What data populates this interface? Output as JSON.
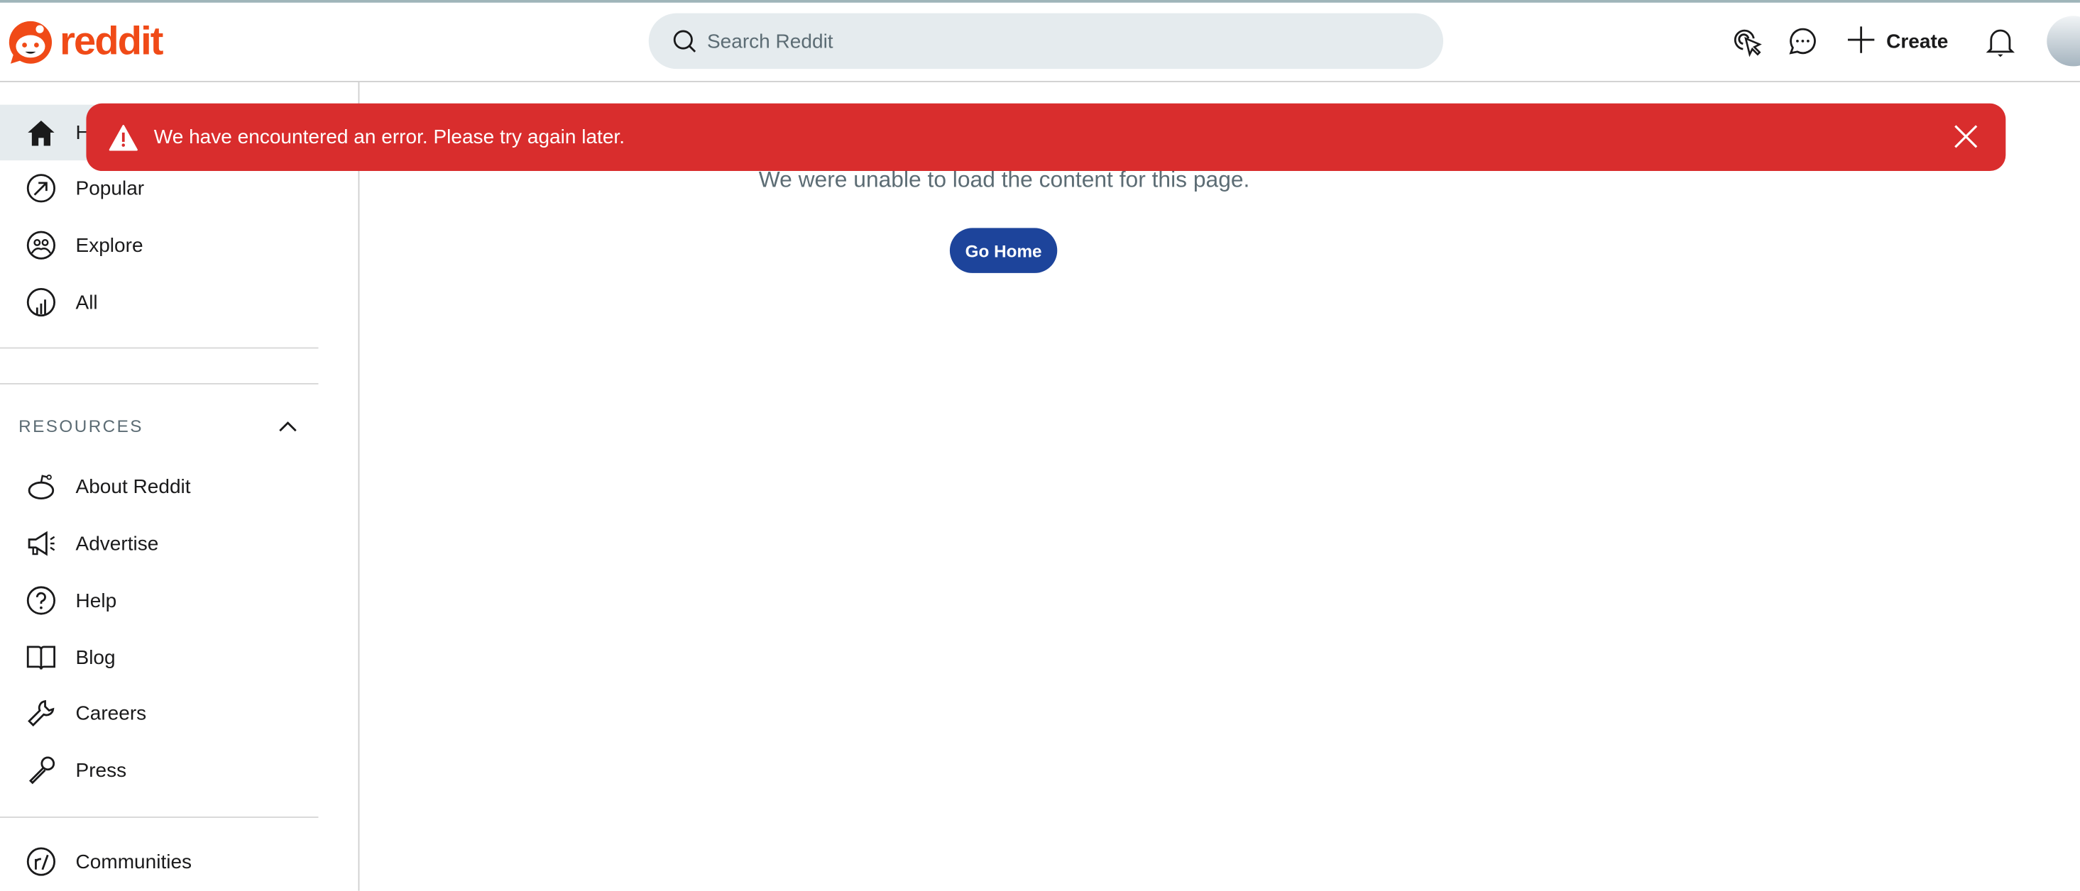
{
  "header": {
    "logo_text": "reddit",
    "search_placeholder": "Search Reddit",
    "create_label": "Create",
    "icons": [
      "advertise-cursor-icon",
      "chat-icon",
      "plus-icon",
      "bell-icon"
    ]
  },
  "sidebar": {
    "items": [
      {
        "label": "Home",
        "icon": "home-icon",
        "active": true
      },
      {
        "label": "Popular",
        "icon": "popular-arrow-icon"
      },
      {
        "label": "Explore",
        "icon": "explore-icon"
      },
      {
        "label": "All",
        "icon": "all-chart-icon"
      }
    ],
    "resources_heading": "RESOURCES",
    "resources": [
      {
        "label": "About Reddit",
        "icon": "reddit-alien-icon"
      },
      {
        "label": "Advertise",
        "icon": "megaphone-icon"
      },
      {
        "label": "Help",
        "icon": "help-icon"
      },
      {
        "label": "Blog",
        "icon": "book-icon"
      },
      {
        "label": "Careers",
        "icon": "wrench-icon"
      },
      {
        "label": "Press",
        "icon": "microphone-icon"
      }
    ],
    "communities_label": "Communities"
  },
  "banner": {
    "message": "We have encountered an error. Please try again later.",
    "color": "#d92d2d"
  },
  "main": {
    "error_text": "We were unable to load the content for this page.",
    "go_home_label": "Go Home",
    "button_color": "#1d449b"
  }
}
